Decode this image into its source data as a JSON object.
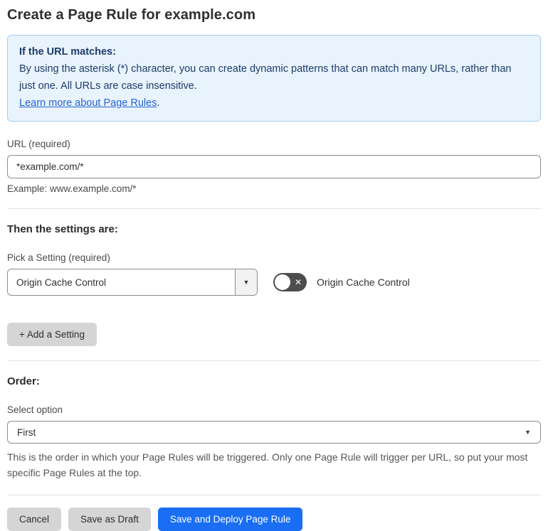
{
  "page": {
    "title": "Create a Page Rule for example.com"
  },
  "info_box": {
    "heading": "If the URL matches:",
    "body": "By using the asterisk (*) character, you can create dynamic patterns that can match many URLs, rather than just one. All URLs are case insensitive.",
    "link_label": "Learn more about Page Rules",
    "link_suffix": "."
  },
  "url_field": {
    "label": "URL (required)",
    "value": "*example.com/*",
    "helper": "Example: www.example.com/*"
  },
  "settings_section": {
    "heading": "Then the settings are:",
    "picker_label": "Pick a Setting (required)",
    "picker_value": "Origin Cache Control",
    "toggle_label": "Origin Cache Control",
    "toggle_state": "off",
    "add_setting_label": "+ Add a Setting"
  },
  "order_section": {
    "heading": "Order:",
    "select_label": "Select option",
    "select_value": "First",
    "helper": "This is the order in which your Page Rules will be triggered. Only one Page Rule will trigger per URL, so put your most specific Page Rules at the top."
  },
  "footer": {
    "cancel_label": "Cancel",
    "save_draft_label": "Save as Draft",
    "save_deploy_label": "Save and Deploy Page Rule"
  },
  "icons": {
    "dropdown_arrow": "▼",
    "toggle_x": "✕"
  },
  "colors": {
    "accent_blue": "#196ef3",
    "info_background": "#e9f3fd",
    "info_border": "#a5cdf0",
    "info_text": "#1c3b69",
    "link_blue": "#2563d4",
    "toggle_off_background": "#4d4d4d",
    "secondary_button_background": "#d5d5d5"
  }
}
